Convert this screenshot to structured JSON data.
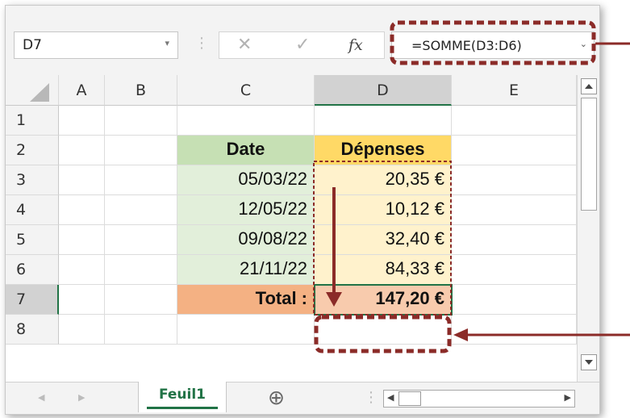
{
  "formula_bar": {
    "name_box": "D7",
    "name_box_dropdown": "▾",
    "grip": "⋮",
    "cancel_icon": "✕",
    "enter_icon": "✓",
    "fx_label": "fx",
    "formula": "=SOMME(D3:D6)",
    "expand_icon": "⌄"
  },
  "columns": [
    "A",
    "B",
    "C",
    "D",
    "E"
  ],
  "rows": [
    "1",
    "2",
    "3",
    "4",
    "5",
    "6",
    "7",
    "8"
  ],
  "table": {
    "headers": {
      "date": "Date",
      "expenses": "Dépenses"
    },
    "rows": [
      {
        "date": "05/03/22",
        "amount": "20,35 €"
      },
      {
        "date": "12/05/22",
        "amount": "10,12 €"
      },
      {
        "date": "09/08/22",
        "amount": "32,40 €"
      },
      {
        "date": "21/11/22",
        "amount": "84,33 €"
      }
    ],
    "total_label": "Total :",
    "total_value": "147,20 €"
  },
  "sheet_tabs": {
    "active": "Feuil1",
    "add_icon": "⊕",
    "prev_icon": "◀",
    "next_icon": "▶"
  },
  "colors": {
    "date_header": "#c6e0b4",
    "date_cells": "#e2efda",
    "expense_header": "#ffd966",
    "expense_cells": "#fff2cc",
    "total_label": "#f4b183",
    "total_value": "#f8cbad",
    "annotation": "#8b2b28",
    "sheet_tab_text": "#217346"
  }
}
